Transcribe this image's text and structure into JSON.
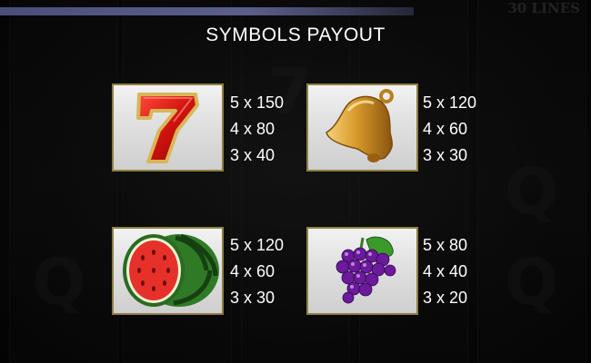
{
  "header": {
    "title": "SYMBOLS PAYOUT",
    "lines_badge": "30 LINES"
  },
  "symbols": [
    {
      "name": "seven",
      "icon": "seven-icon",
      "payouts": [
        "5 x 150",
        "4 x 80",
        "3 x 40"
      ]
    },
    {
      "name": "bell",
      "icon": "bell-icon",
      "payouts": [
        "5 x 120",
        "4 x 60",
        "3 x 30"
      ]
    },
    {
      "name": "watermelon",
      "icon": "watermelon-icon",
      "payouts": [
        "5 x 120",
        "4 x 60",
        "3 x 30"
      ]
    },
    {
      "name": "grapes",
      "icon": "grapes-icon",
      "payouts": [
        "5 x 80",
        "4 x 40",
        "3 x 20"
      ]
    }
  ],
  "colors": {
    "card_border": "#8e7f43",
    "top_bar": "#5b5f8c",
    "text": "#ffffff"
  }
}
